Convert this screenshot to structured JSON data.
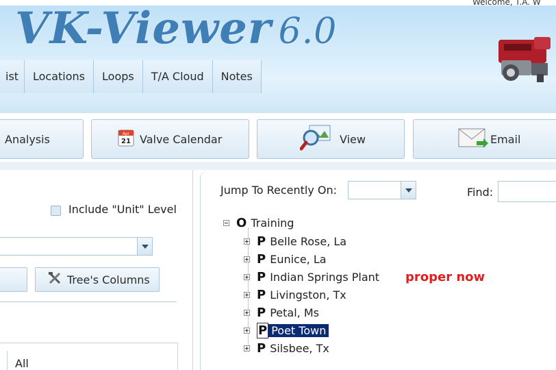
{
  "app": {
    "title": "VK-Viewer",
    "version": "6.0",
    "welcome": "Welcome, T.A. W"
  },
  "nav": {
    "tabs": [
      {
        "label": "ist"
      },
      {
        "label": "Locations"
      },
      {
        "label": "Loops"
      },
      {
        "label": "T/A Cloud"
      },
      {
        "label": "Notes"
      }
    ]
  },
  "toolbar": {
    "analysis_label": "Analysis",
    "valve_calendar_label": "Valve Calendar",
    "calendar_month": "Apr",
    "calendar_day": "21",
    "view_label": "View",
    "email_label": "Email"
  },
  "left": {
    "include_unit_label": "Include \"Unit\" Level",
    "include_unit_checked": false,
    "dropdown_value": "",
    "trees_columns_label": "Tree's Columns",
    "list_first": "All"
  },
  "right": {
    "jump_label": "Jump To Recently On:",
    "jump_value": "",
    "find_label": "Find:",
    "find_value": "",
    "note": "proper now"
  },
  "tree": {
    "root": {
      "letter": "O",
      "label": "Training"
    },
    "children": [
      {
        "letter": "P",
        "label": "Belle Rose, La"
      },
      {
        "letter": "P",
        "label": "Eunice, La"
      },
      {
        "letter": "P",
        "label": "Indian Springs Plant"
      },
      {
        "letter": "P",
        "label": "Livingston, Tx"
      },
      {
        "letter": "P",
        "label": "Petal, Ms"
      },
      {
        "letter": "P",
        "label": "Poet Town",
        "selected": true
      },
      {
        "letter": "P",
        "label": "Silsbee, Tx"
      }
    ]
  },
  "colors": {
    "title_blue": "#3f7fb6",
    "selection": "#0a2b74",
    "note_red": "#e01f1f"
  }
}
